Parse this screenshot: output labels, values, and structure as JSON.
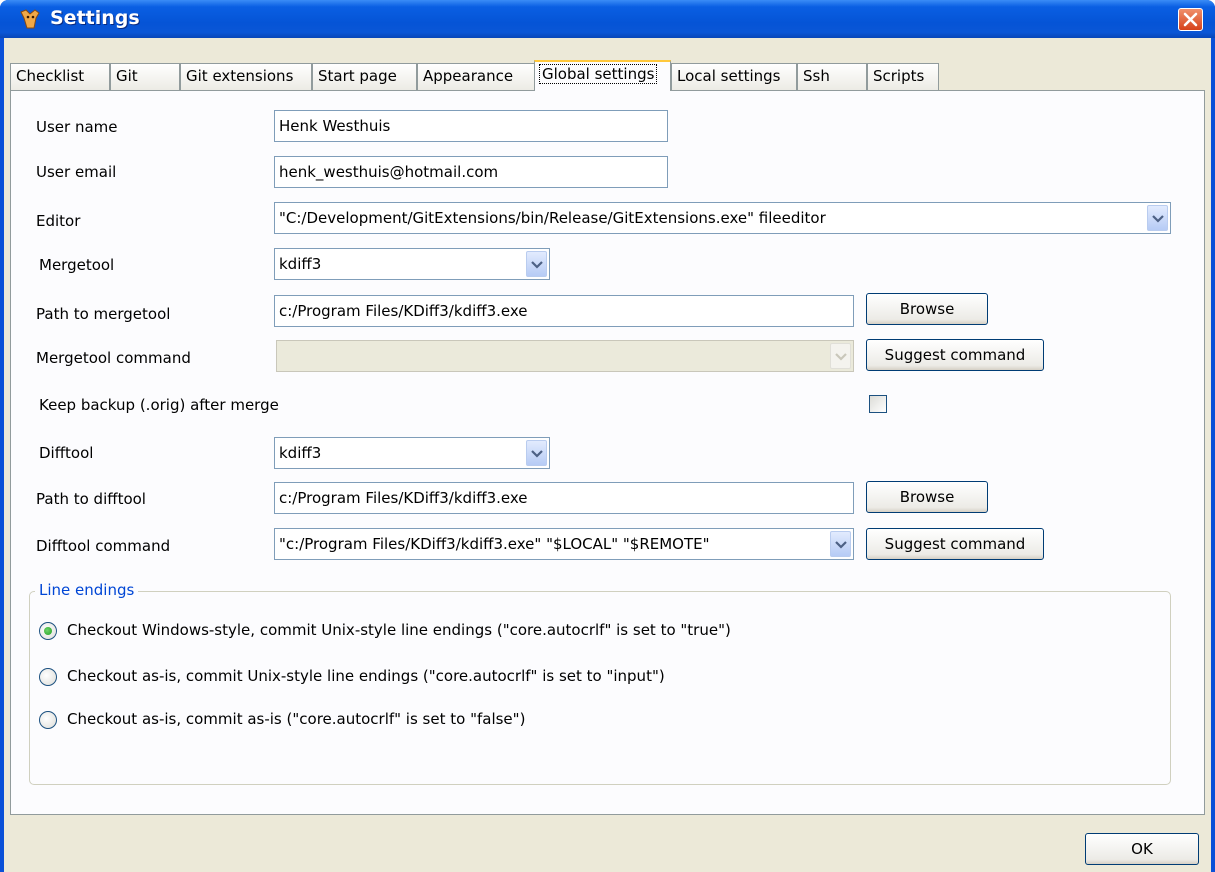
{
  "window": {
    "title": "Settings"
  },
  "tabs": [
    {
      "label": "Checklist"
    },
    {
      "label": "Git"
    },
    {
      "label": "Git extensions"
    },
    {
      "label": "Start page"
    },
    {
      "label": "Appearance"
    },
    {
      "label": "Global settings",
      "active": true
    },
    {
      "label": "Local settings"
    },
    {
      "label": "Ssh"
    },
    {
      "label": "Scripts"
    }
  ],
  "form": {
    "user_name": {
      "label": "User name",
      "value": "Henk Westhuis"
    },
    "user_email": {
      "label": "User email",
      "value": "henk_westhuis@hotmail.com"
    },
    "editor": {
      "label": "Editor",
      "value": "\"C:/Development/GitExtensions/bin/Release/GitExtensions.exe\" fileeditor"
    },
    "mergetool": {
      "label": "Mergetool",
      "value": "kdiff3"
    },
    "mergetool_path": {
      "label": "Path to mergetool",
      "value": "c:/Program Files/KDiff3/kdiff3.exe",
      "browse": "Browse"
    },
    "mergetool_command": {
      "label": "Mergetool command",
      "value": "",
      "suggest": "Suggest command"
    },
    "keep_backup": {
      "label": "Keep backup (.orig) after merge",
      "checked": false
    },
    "difftool": {
      "label": "Difftool",
      "value": "kdiff3"
    },
    "difftool_path": {
      "label": "Path to difftool",
      "value": "c:/Program Files/KDiff3/kdiff3.exe",
      "browse": "Browse"
    },
    "difftool_command": {
      "label": "Difftool command",
      "value": "\"c:/Program Files/KDiff3/kdiff3.exe\" \"$LOCAL\" \"$REMOTE\"",
      "suggest": "Suggest command"
    }
  },
  "line_endings": {
    "title": "Line endings",
    "options": [
      {
        "label": "Checkout Windows-style, commit Unix-style line endings (\"core.autocrlf\"  is set to \"true\")",
        "selected": true
      },
      {
        "label": "Checkout as-is, commit Unix-style line endings (\"core.autocrlf\"  is set to \"input\")",
        "selected": false
      },
      {
        "label": "Checkout as-is, commit as-is (\"core.autocrlf\"  is set to \"false\")",
        "selected": false
      }
    ]
  },
  "footer": {
    "ok_label": "OK"
  },
  "colors": {
    "titlebar": "#0554d6",
    "face": "#ece9d8",
    "panel": "#fcfcfe",
    "group_title": "#0046d5",
    "close": "#d6421a"
  },
  "icons": [
    "app-icon",
    "close-icon",
    "chevron-down-icon"
  ]
}
